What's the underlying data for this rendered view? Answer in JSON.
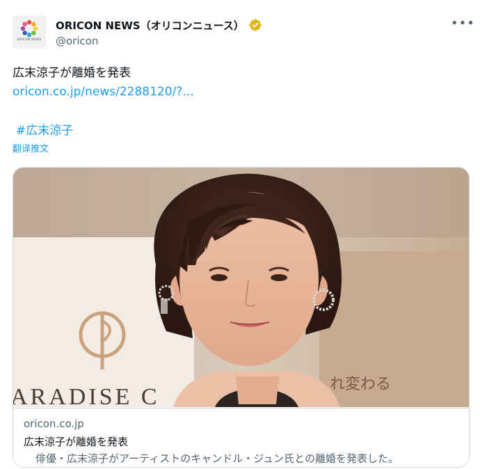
{
  "account": {
    "display_name": "ORICON NEWS（オリコンニュース）",
    "handle": "@oricon",
    "avatar_logo_text": "ORICON NEWS",
    "avatar_logo_colors": [
      "#e94e3c",
      "#f7a823",
      "#f3d23a",
      "#6cbf4b",
      "#2fa6d9",
      "#3a58a8",
      "#9b4b9e",
      "#e8568f"
    ],
    "verified_color": "#e2b719"
  },
  "menu": {
    "more_label": "•••"
  },
  "tweet": {
    "text": "広末涼子が離婚を発表",
    "link": "oricon.co.jp/news/2288120/?...",
    "hashtag": "#広末涼子",
    "translate_label": "翻译推文"
  },
  "card": {
    "image_signage_text": "ARADISE C",
    "image_right_text": "れ変わる",
    "domain": "oricon.co.jp",
    "title": "広末涼子が離婚を発表",
    "description": "俳優・広末涼子がアーティストのキャンドル・ジュン氏との離婚を発表した。"
  },
  "colors": {
    "link": "#1d9bf0",
    "secondary_text": "#536471",
    "primary_text": "#0f1419",
    "border": "#cfd9de"
  }
}
